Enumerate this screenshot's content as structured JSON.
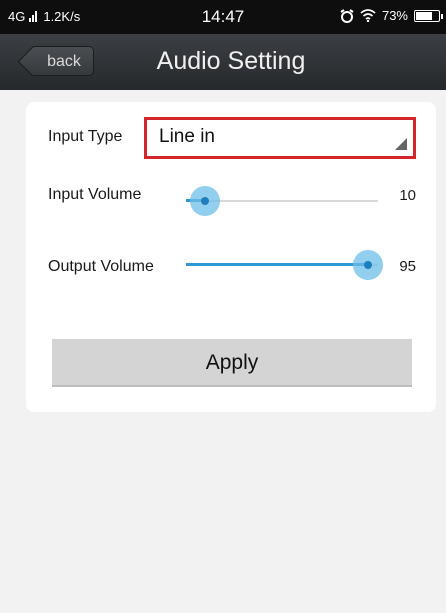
{
  "status_bar": {
    "network": "4G",
    "speed": "1.2K/s",
    "time": "14:47",
    "battery": "73%",
    "battery_level": 0.73,
    "icons": [
      "signal-icon",
      "alarm-icon",
      "wifi-icon",
      "battery-icon"
    ]
  },
  "nav": {
    "back_label": "back",
    "title": "Audio Setting"
  },
  "form": {
    "input_type": {
      "label": "Input Type",
      "value": "Line in",
      "highlight_color": "#d5252c"
    },
    "input_volume": {
      "label": "Input Volume",
      "value": "10",
      "level": 0.1
    },
    "output_volume": {
      "label": "Output Volume",
      "value": "95",
      "level": 0.95
    },
    "apply_label": "Apply"
  },
  "colors": {
    "accent": "#2f99d3",
    "nav_background": "#2e3134",
    "highlight": "#d5252c"
  }
}
